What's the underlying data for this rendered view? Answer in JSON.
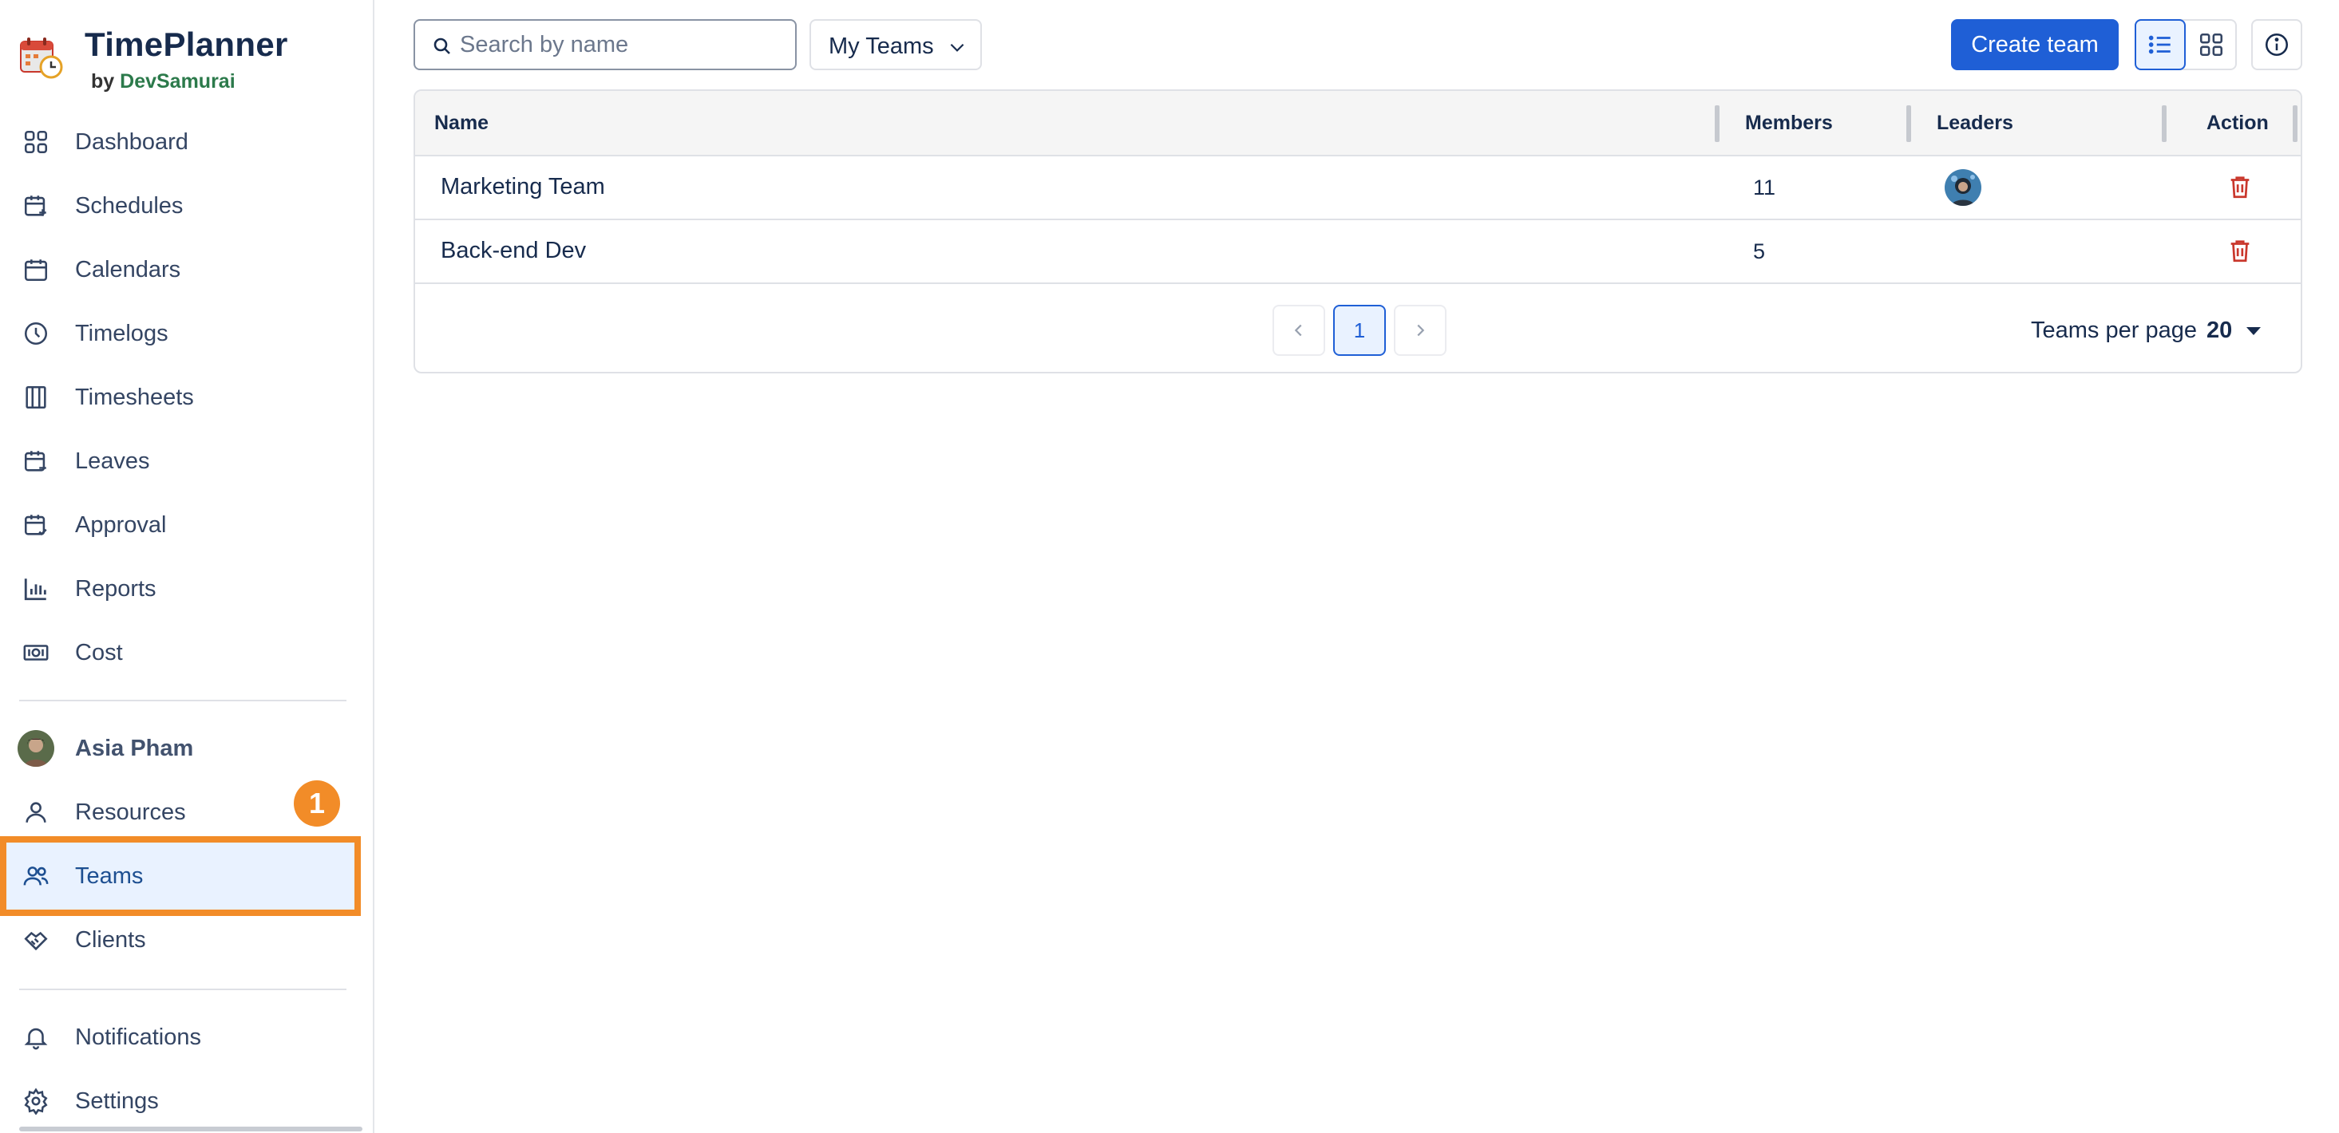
{
  "brand": {
    "title": "TimePlanner",
    "by": "by",
    "maker": "DevSamurai",
    "accent": "#2c7a4b"
  },
  "sidebar": {
    "items": [
      {
        "label": "Dashboard",
        "icon": "dashboard-icon"
      },
      {
        "label": "Schedules",
        "icon": "schedule-icon"
      },
      {
        "label": "Calendars",
        "icon": "calendar-icon"
      },
      {
        "label": "Timelogs",
        "icon": "clock-icon"
      },
      {
        "label": "Timesheets",
        "icon": "timesheet-icon"
      },
      {
        "label": "Leaves",
        "icon": "leave-icon"
      },
      {
        "label": "Approval",
        "icon": "approval-icon"
      },
      {
        "label": "Reports",
        "icon": "chart-icon"
      },
      {
        "label": "Cost",
        "icon": "cost-icon"
      }
    ],
    "user": {
      "name": "Asia Pham"
    },
    "people_items": [
      {
        "label": "Resources",
        "icon": "person-icon"
      },
      {
        "label": "Teams",
        "icon": "teams-icon",
        "active": true
      },
      {
        "label": "Clients",
        "icon": "handshake-icon"
      }
    ],
    "bottom_items": [
      {
        "label": "Notifications",
        "icon": "bell-icon"
      },
      {
        "label": "Settings",
        "icon": "gear-icon"
      }
    ],
    "step_badge": "1",
    "highlight_color": "#f28c28"
  },
  "toolbar": {
    "search_placeholder": "Search by name",
    "filter_value": "My Teams",
    "create_label": "Create team",
    "primary_color": "#1f5fd6"
  },
  "table": {
    "columns": [
      "Name",
      "Members",
      "Leaders",
      "Action"
    ],
    "rows": [
      {
        "name": "Marketing Team",
        "members": "11",
        "has_leader": true
      },
      {
        "name": "Back-end Dev",
        "members": "5",
        "has_leader": false
      }
    ],
    "delete_color": "#c9372c"
  },
  "pagination": {
    "current_page": "1",
    "per_page_label": "Teams per page",
    "per_page_value": "20"
  }
}
